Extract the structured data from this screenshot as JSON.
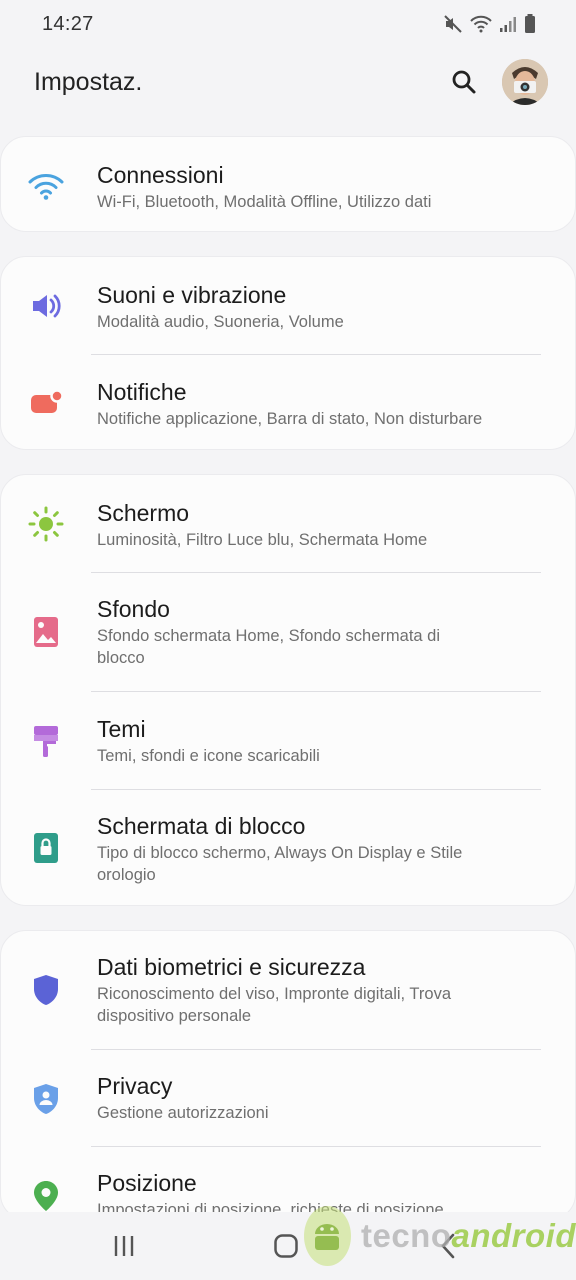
{
  "status": {
    "time": "14:27"
  },
  "header": {
    "title": "Impostaz."
  },
  "groups": [
    [
      {
        "title": "Connessioni",
        "subtitle": "Wi-Fi, Bluetooth, Modalità Offline, Utilizzo dati",
        "icon": "wifi-icon",
        "color": "#4aa3df"
      }
    ],
    [
      {
        "title": "Suoni e vibrazione",
        "subtitle": "Modalità audio, Suoneria, Volume",
        "icon": "volume-icon",
        "color": "#6d6be0"
      },
      {
        "title": "Notifiche",
        "subtitle": "Notifiche applicazione, Barra di stato, Non disturbare",
        "icon": "notification-icon",
        "color": "#ef6b5e"
      }
    ],
    [
      {
        "title": "Schermo",
        "subtitle": "Luminosità, Filtro Luce blu, Schermata Home",
        "icon": "brightness-icon",
        "color": "#8cc63f"
      },
      {
        "title": "Sfondo",
        "subtitle": "Sfondo schermata Home, Sfondo schermata di blocco",
        "icon": "wallpaper-icon",
        "color": "#e56b8a"
      },
      {
        "title": "Temi",
        "subtitle": "Temi, sfondi e icone scaricabili",
        "icon": "theme-brush-icon",
        "color": "#b36ad9"
      },
      {
        "title": "Schermata di blocco",
        "subtitle": "Tipo di blocco schermo, Always On Display e Stile orologio",
        "icon": "lock-icon",
        "color": "#2f9d8a"
      }
    ],
    [
      {
        "title": "Dati biometrici e sicurezza",
        "subtitle": "Riconoscimento del viso, Impronte digitali, Trova dispositivo personale",
        "icon": "shield-icon",
        "color": "#5b63d6"
      },
      {
        "title": "Privacy",
        "subtitle": "Gestione autorizzazioni",
        "icon": "privacy-shield-icon",
        "color": "#6aa0e8"
      },
      {
        "title": "Posizione",
        "subtitle": "Impostazioni di posizione, richieste di posizione",
        "icon": "location-pin-icon",
        "color": "#4caf50"
      }
    ]
  ],
  "watermark": {
    "part1": "tecno",
    "part2": "android"
  }
}
